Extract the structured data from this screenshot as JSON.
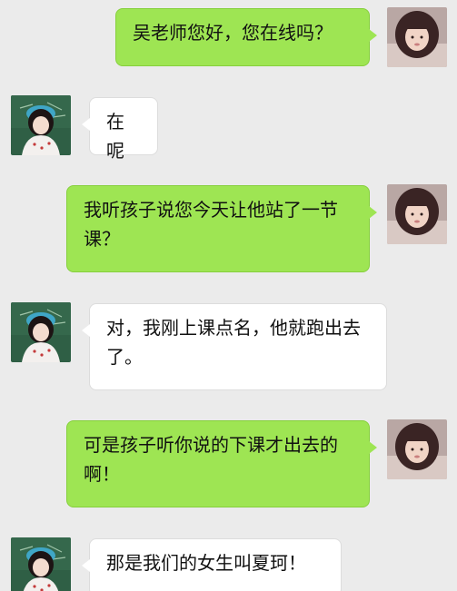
{
  "messages": [
    {
      "side": "sent",
      "text": "吴老师您好，您在线吗？"
    },
    {
      "side": "received",
      "text": "在呢"
    },
    {
      "side": "sent",
      "text": "我听孩子说您今天让他站了一节课？"
    },
    {
      "side": "received",
      "text": "对，我刚上课点名，他就跑出去了。"
    },
    {
      "side": "sent",
      "text": "可是孩子听你说的下课才出去的啊！"
    },
    {
      "side": "received",
      "text": "那是我们的女生叫夏珂！"
    }
  ],
  "colors": {
    "background": "#ebebeb",
    "sent_bubble": "#9ee553",
    "received_bubble": "#ffffff"
  }
}
